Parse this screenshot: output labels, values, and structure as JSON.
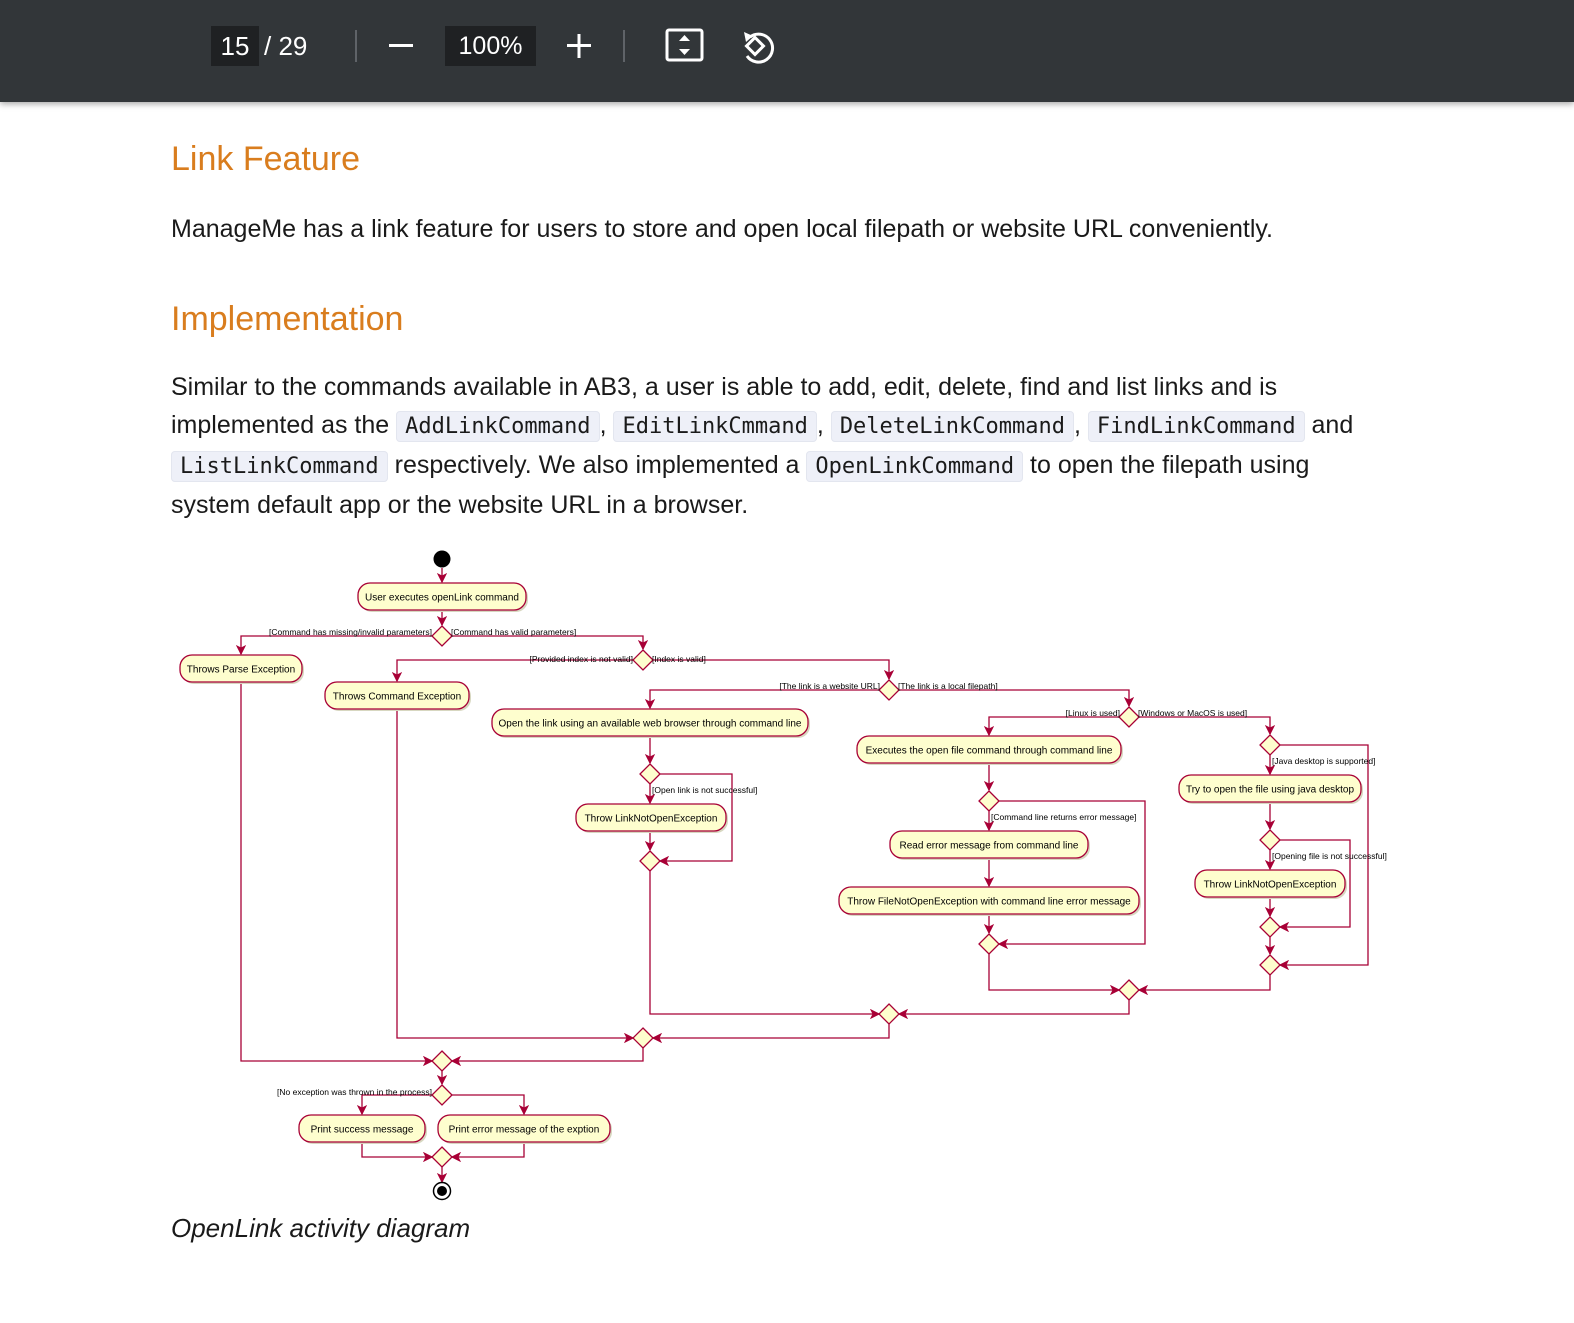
{
  "toolbar": {
    "current_page": "15",
    "page_separator": "/ 29",
    "zoom": "100%"
  },
  "document": {
    "heading1": "Link Feature",
    "intro": "ManageMe has a link feature for users to store and open local filepath or website URL conveniently.",
    "heading2": "Implementation",
    "impl": {
      "t1": "Similar to the commands available in AB3, a user is able to add, edit, delete, find and list links and is implemented as the ",
      "c1": "AddLinkCommand",
      "t2": ", ",
      "c2": "EditLinkCmmand",
      "t3": ", ",
      "c3": "DeleteLinkCommand",
      "t4": ", ",
      "c4": "FindLinkCommand",
      "t5": " and ",
      "c5": "ListLinkCommand",
      "t6": " respectively. We also implemented a ",
      "c6": "OpenLinkCommand",
      "t7": " to open the filepath using system default app or the website URL in a browser."
    },
    "caption": "OpenLink activity diagram"
  },
  "diagram": {
    "nodes": {
      "user_executes": "User executes openLink command",
      "throws_parse": "Throws Parse Exception",
      "throws_command": "Throws Command Exception",
      "open_browser": "Open the link using an available web browser through command line",
      "throw_linknotopen_1": "Throw LinkNotOpenException",
      "executes_open_file": "Executes the open file command through command line",
      "read_error": "Read error message from command line",
      "throw_filenotopen": "Throw FileNotOpenException with command line error message",
      "try_java_desktop": "Try to open the file using java desktop",
      "throw_linknotopen_2": "Throw LinkNotOpenException",
      "print_success": "Print success message",
      "print_error": "Print error message of the exption"
    },
    "guards": {
      "missing_params": "[Command has missing/invalid parameters]",
      "valid_params": "[Command has valid parameters]",
      "index_not_valid": "[Provided index is not valid]",
      "index_valid": "[Index is valid]",
      "website_url": "[The link is a website URL]",
      "local_filepath": "[The link is a local filepath]",
      "linux_used": "[Linux is used]",
      "windows_mac_used": "[Windows or MacOS is used]",
      "java_desktop_supported": "[Java desktop is supported]",
      "open_link_not_successful": "[Open link is not successful]",
      "cmd_returns_error": "[Command line returns error message]",
      "opening_file_not_successful": "[Opening file is not successful]",
      "no_exception": "[No exception was thrown in the process]"
    }
  },
  "colors": {
    "toolbar_bg": "#323639",
    "heading": "#d97d1e",
    "node_fill": "#fefece",
    "node_stroke": "#a80036"
  }
}
